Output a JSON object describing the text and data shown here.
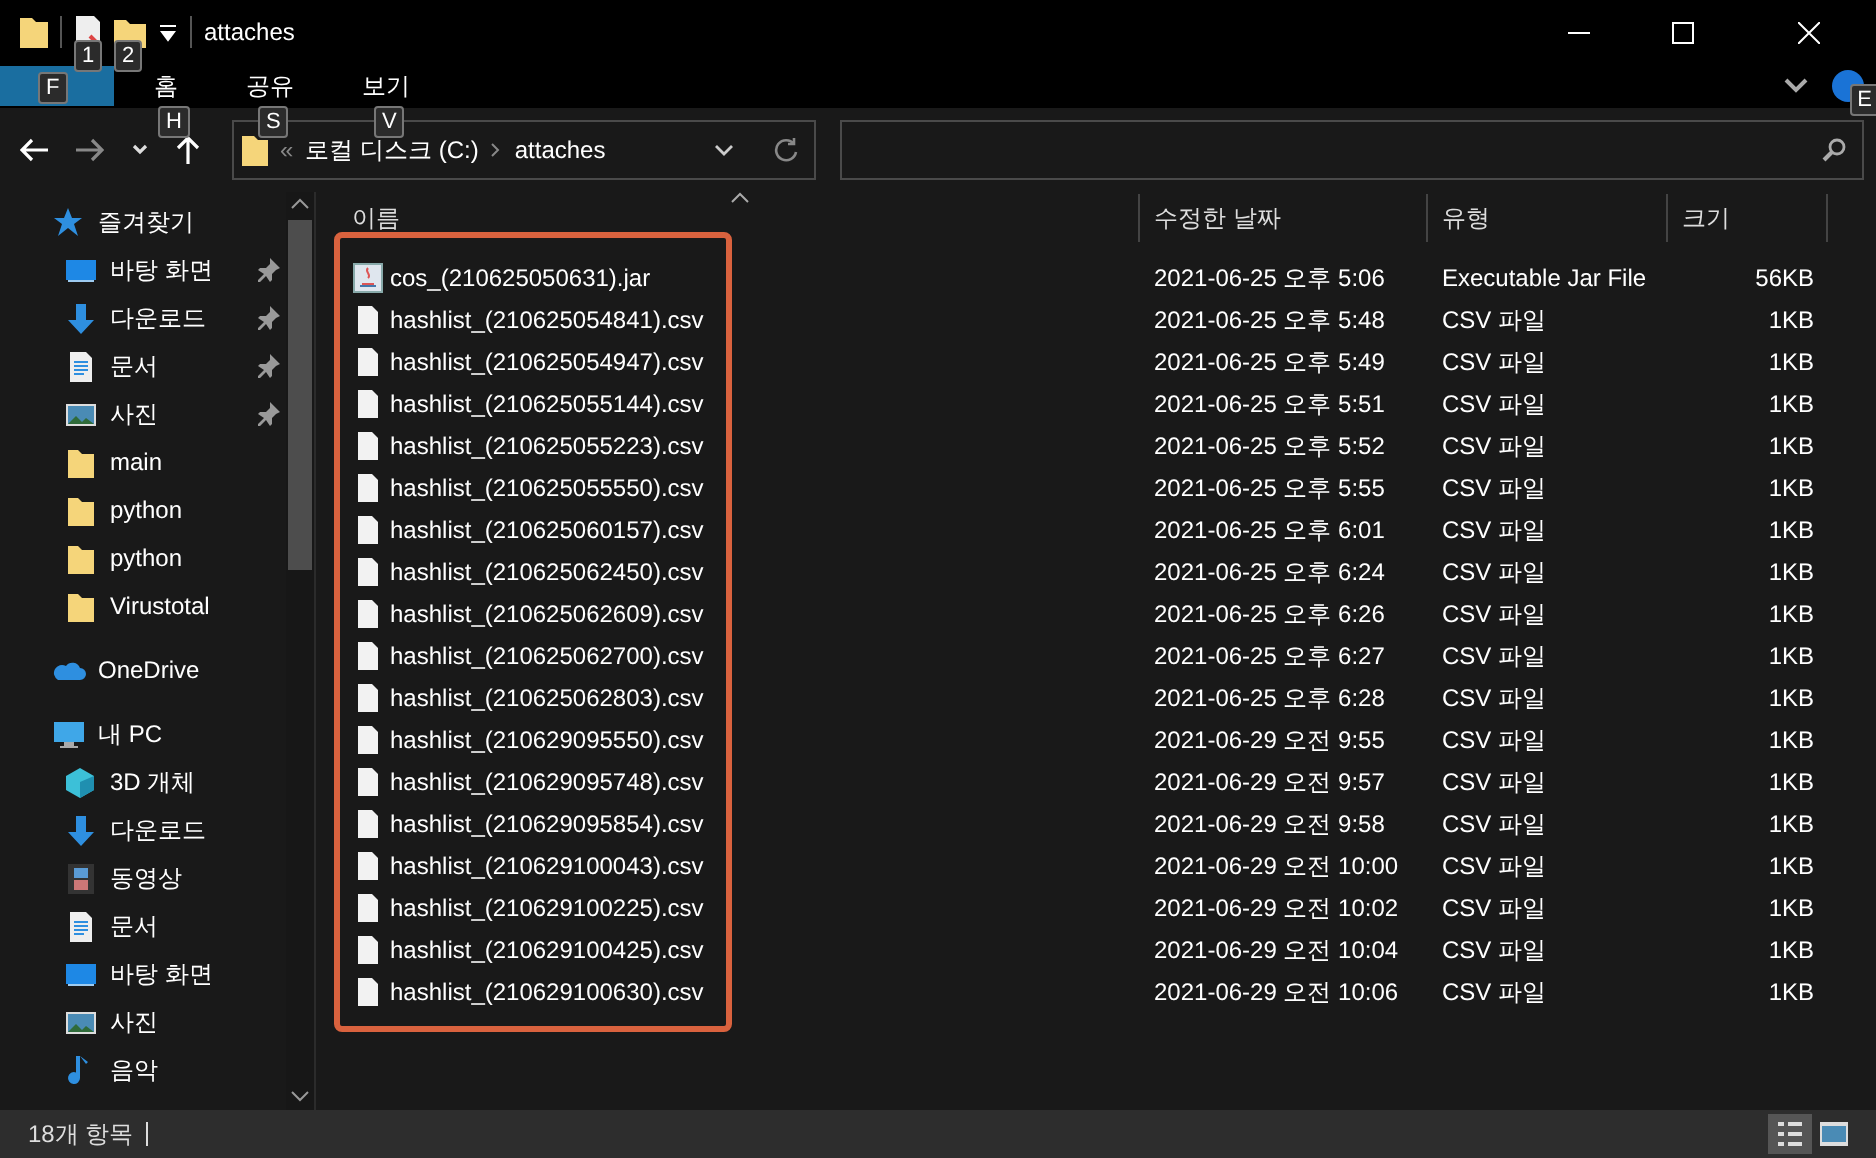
{
  "window": {
    "title": "attaches"
  },
  "quick_access_keytips": [
    "1",
    "2"
  ],
  "ribbon": {
    "tabs": [
      {
        "keytip": "F",
        "selected": true
      },
      {
        "label": "홈",
        "keytip": "H",
        "selected": false
      },
      {
        "label": "공유",
        "keytip": "S",
        "selected": false
      },
      {
        "label": "보기",
        "keytip": "V",
        "selected": false
      }
    ],
    "edge_keytip": "E"
  },
  "address": {
    "overflow": "«",
    "segments": [
      "로컬 디스크 (C:)",
      "attaches"
    ]
  },
  "sidebar": {
    "items": [
      {
        "label": "즐겨찾기",
        "kind": "star",
        "children": [
          {
            "label": "바탕 화면",
            "kind": "desktop",
            "pinned": true
          },
          {
            "label": "다운로드",
            "kind": "download",
            "pinned": true
          },
          {
            "label": "문서",
            "kind": "document",
            "pinned": true
          },
          {
            "label": "사진",
            "kind": "picture",
            "pinned": true
          },
          {
            "label": "main",
            "kind": "folder",
            "pinned": false
          },
          {
            "label": "python",
            "kind": "folder",
            "pinned": false
          },
          {
            "label": "python",
            "kind": "folder",
            "pinned": false
          },
          {
            "label": "Virustotal",
            "kind": "folder",
            "pinned": false
          }
        ]
      },
      {
        "label": "OneDrive",
        "kind": "cloud"
      },
      {
        "label": "내 PC",
        "kind": "pc",
        "children": [
          {
            "label": "3D 개체",
            "kind": "cube",
            "pinned": false
          },
          {
            "label": "다운로드",
            "kind": "download",
            "pinned": false
          },
          {
            "label": "동영상",
            "kind": "film",
            "pinned": false
          },
          {
            "label": "문서",
            "kind": "document",
            "pinned": false
          },
          {
            "label": "바탕 화면",
            "kind": "desktop",
            "pinned": false
          },
          {
            "label": "사진",
            "kind": "picture",
            "pinned": false
          },
          {
            "label": "음악",
            "kind": "music",
            "pinned": false
          }
        ]
      }
    ]
  },
  "table": {
    "columns": [
      "이름",
      "수정한 날짜",
      "유형",
      "크기"
    ],
    "rows": [
      {
        "kind": "jar",
        "name": "cos_(210625050631).jar",
        "date": "2021-06-25 오후 5:06",
        "type": "Executable Jar File",
        "size": "56KB"
      },
      {
        "kind": "csv",
        "name": "hashlist_(210625054841).csv",
        "date": "2021-06-25 오후 5:48",
        "type": "CSV 파일",
        "size": "1KB"
      },
      {
        "kind": "csv",
        "name": "hashlist_(210625054947).csv",
        "date": "2021-06-25 오후 5:49",
        "type": "CSV 파일",
        "size": "1KB"
      },
      {
        "kind": "csv",
        "name": "hashlist_(210625055144).csv",
        "date": "2021-06-25 오후 5:51",
        "type": "CSV 파일",
        "size": "1KB"
      },
      {
        "kind": "csv",
        "name": "hashlist_(210625055223).csv",
        "date": "2021-06-25 오후 5:52",
        "type": "CSV 파일",
        "size": "1KB"
      },
      {
        "kind": "csv",
        "name": "hashlist_(210625055550).csv",
        "date": "2021-06-25 오후 5:55",
        "type": "CSV 파일",
        "size": "1KB"
      },
      {
        "kind": "csv",
        "name": "hashlist_(210625060157).csv",
        "date": "2021-06-25 오후 6:01",
        "type": "CSV 파일",
        "size": "1KB"
      },
      {
        "kind": "csv",
        "name": "hashlist_(210625062450).csv",
        "date": "2021-06-25 오후 6:24",
        "type": "CSV 파일",
        "size": "1KB"
      },
      {
        "kind": "csv",
        "name": "hashlist_(210625062609).csv",
        "date": "2021-06-25 오후 6:26",
        "type": "CSV 파일",
        "size": "1KB"
      },
      {
        "kind": "csv",
        "name": "hashlist_(210625062700).csv",
        "date": "2021-06-25 오후 6:27",
        "type": "CSV 파일",
        "size": "1KB"
      },
      {
        "kind": "csv",
        "name": "hashlist_(210625062803).csv",
        "date": "2021-06-25 오후 6:28",
        "type": "CSV 파일",
        "size": "1KB"
      },
      {
        "kind": "csv",
        "name": "hashlist_(210629095550).csv",
        "date": "2021-06-29 오전 9:55",
        "type": "CSV 파일",
        "size": "1KB"
      },
      {
        "kind": "csv",
        "name": "hashlist_(210629095748).csv",
        "date": "2021-06-29 오전 9:57",
        "type": "CSV 파일",
        "size": "1KB"
      },
      {
        "kind": "csv",
        "name": "hashlist_(210629095854).csv",
        "date": "2021-06-29 오전 9:58",
        "type": "CSV 파일",
        "size": "1KB"
      },
      {
        "kind": "csv",
        "name": "hashlist_(210629100043).csv",
        "date": "2021-06-29 오전 10:00",
        "type": "CSV 파일",
        "size": "1KB"
      },
      {
        "kind": "csv",
        "name": "hashlist_(210629100225).csv",
        "date": "2021-06-29 오전 10:02",
        "type": "CSV 파일",
        "size": "1KB"
      },
      {
        "kind": "csv",
        "name": "hashlist_(210629100425).csv",
        "date": "2021-06-29 오전 10:04",
        "type": "CSV 파일",
        "size": "1KB"
      },
      {
        "kind": "csv",
        "name": "hashlist_(210629100630).csv",
        "date": "2021-06-29 오전 10:06",
        "type": "CSV 파일",
        "size": "1KB"
      }
    ]
  },
  "status_bar": {
    "count": "18개 항목"
  }
}
